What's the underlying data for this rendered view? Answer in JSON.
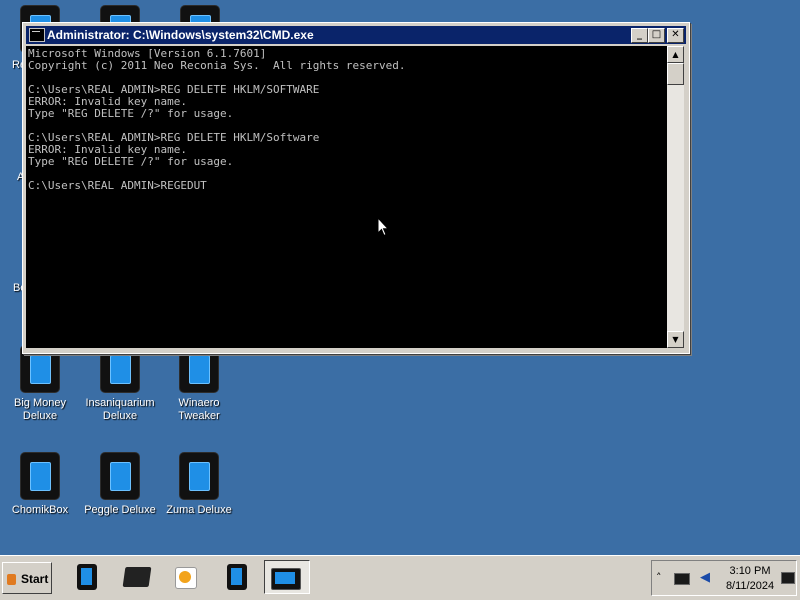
{
  "window": {
    "title": "Administrator: C:\\Windows\\system32\\CMD.exe",
    "buttons": {
      "minimize": "_",
      "maximize": "□",
      "close": "✕"
    }
  },
  "console": {
    "lines": [
      "Microsoft Windows [Version 6.1.7601]",
      "Copyright (c) 2011 Neo Reconia Sys.  All rights reserved.",
      "",
      "C:\\Users\\REAL ADMIN>REG DELETE HKLM/SOFTWARE",
      "ERROR: Invalid key name.",
      "Type \"REG DELETE /?\" for usage.",
      "",
      "C:\\Users\\REAL ADMIN>REG DELETE HKLM/Software",
      "ERROR: Invalid key name.",
      "Type \"REG DELETE /?\" for usage.",
      "",
      "C:\\Users\\REAL ADMIN>REGEDUT"
    ]
  },
  "desktop": {
    "edge_fragments": [
      "Re",
      "A",
      "Bo"
    ],
    "icons": [
      {
        "label": "Big Money Deluxe",
        "icon": "game-icon"
      },
      {
        "label": "Insaniquarium Deluxe",
        "icon": "game-icon"
      },
      {
        "label": "Winaero Tweaker",
        "icon": "app-icon"
      },
      {
        "label": "ChomikBox",
        "icon": "app-icon"
      },
      {
        "label": "Peggle Deluxe",
        "icon": "game-icon"
      },
      {
        "label": "Zuma Deluxe",
        "icon": "game-icon"
      }
    ]
  },
  "taskbar": {
    "start_label": "Start",
    "apps": [
      {
        "name": "pinned-app-icon"
      },
      {
        "name": "archive-box-icon"
      },
      {
        "name": "media-player-icon"
      },
      {
        "name": "pinned-app-icon"
      },
      {
        "name": "cmd-icon",
        "active": true
      }
    ],
    "tray": {
      "time": "3:10 PM",
      "date": "8/11/2024",
      "chevron": "˄",
      "speaker": "◀"
    }
  }
}
